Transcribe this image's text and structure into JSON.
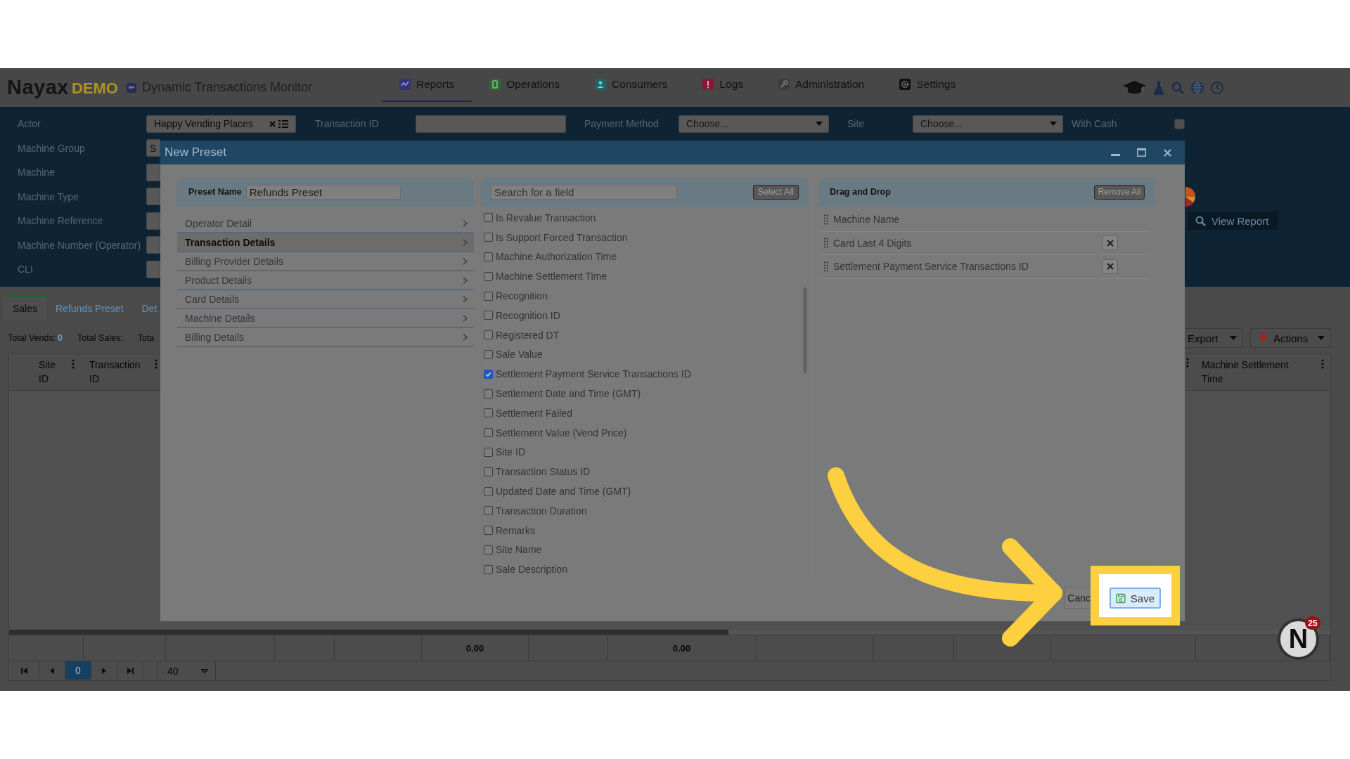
{
  "header": {
    "logo": "Nayax",
    "logo_badge": "DEMO",
    "app_title": "Dynamic Transactions Monitor",
    "nav": [
      {
        "label": "Reports",
        "selected": true
      },
      {
        "label": "Operations",
        "selected": false
      },
      {
        "label": "Consumers",
        "selected": false
      },
      {
        "label": "Logs",
        "selected": false
      },
      {
        "label": "Administration",
        "selected": false
      },
      {
        "label": "Settings",
        "selected": false
      }
    ]
  },
  "filters": {
    "actor": {
      "label": "Actor",
      "value": "Happy Vending Places"
    },
    "transaction_id": {
      "label": "Transaction ID"
    },
    "payment_method": {
      "label": "Payment Method",
      "placeholder": "Choose..."
    },
    "site": {
      "label": "Site",
      "placeholder": "Choose..."
    },
    "with_cash": {
      "label": "With Cash",
      "checked": false
    },
    "rows": [
      {
        "label": "Machine Group",
        "value": "S"
      },
      {
        "label": "Machine"
      },
      {
        "label": "Machine Type"
      },
      {
        "label": "Machine Reference"
      },
      {
        "label": "Machine Number (Operator)"
      },
      {
        "label": "CLI"
      }
    ],
    "view_report": "View Report"
  },
  "report_tabs": [
    {
      "label": "Sales",
      "selected": true
    },
    {
      "label": "Refunds Preset",
      "selected": false
    },
    {
      "label": "Det",
      "selected": false
    }
  ],
  "stats": [
    {
      "label": "Total Vends:",
      "value": "0"
    },
    {
      "label": "Total Sales:"
    },
    {
      "label": "Tota"
    }
  ],
  "toolbar": {
    "export": "Export",
    "actions": "Actions"
  },
  "table": {
    "columns": [
      {
        "label": "Site ID"
      },
      {
        "label": "Transaction ID"
      }
    ],
    "right_columns": [
      {
        "label": "Machine Settlement Time"
      }
    ],
    "totals": [
      "0.00",
      "0.00"
    ]
  },
  "pager": {
    "pages": [
      {
        "label": "0",
        "selected": true
      }
    ],
    "page_size": "40"
  },
  "chat": {
    "label": "N",
    "badge": "25"
  },
  "dialog": {
    "title": "New Preset",
    "preset_name": {
      "label": "Preset Name",
      "value": "Refunds Preset"
    },
    "categories": [
      {
        "label": "Operator Detail",
        "selected": false
      },
      {
        "label": "Transaction Details",
        "selected": true
      },
      {
        "label": "Billing Provider Details",
        "selected": false
      },
      {
        "label": "Product Details",
        "selected": false
      },
      {
        "label": "Card Details",
        "selected": false
      },
      {
        "label": "Machine Details",
        "selected": false
      },
      {
        "label": "Billing Details",
        "selected": false
      }
    ],
    "field_search": {
      "placeholder": "Search for a field"
    },
    "select_all": "Select All",
    "fields": [
      {
        "label": "Is Revalue Transaction",
        "checked": false
      },
      {
        "label": "Is Support Forced Transaction",
        "checked": false
      },
      {
        "label": "Machine Authorization Time",
        "checked": false
      },
      {
        "label": "Machine Settlement Time",
        "checked": false
      },
      {
        "label": "Recognition",
        "checked": false
      },
      {
        "label": "Recognition ID",
        "checked": false
      },
      {
        "label": "Registered DT",
        "checked": false
      },
      {
        "label": "Sale Value",
        "checked": false
      },
      {
        "label": "Settlement Payment Service Transactions ID",
        "checked": true
      },
      {
        "label": "Settlement Date and Time (GMT)",
        "checked": false
      },
      {
        "label": "Settlement Failed",
        "checked": false
      },
      {
        "label": "Settlement Value (Vend Price)",
        "checked": false
      },
      {
        "label": "Site ID",
        "checked": false
      },
      {
        "label": "Transaction Status ID",
        "checked": false
      },
      {
        "label": "Updated Date and Time (GMT)",
        "checked": false
      },
      {
        "label": "Transaction Duration",
        "checked": false
      },
      {
        "label": "Remarks",
        "checked": false
      },
      {
        "label": "Site Name",
        "checked": false
      },
      {
        "label": "Sale Description",
        "checked": false
      }
    ],
    "drag_title": "Drag and Drop",
    "remove_all": "Remove All",
    "selected_fields": [
      {
        "label": "Machine Name",
        "removable": false
      },
      {
        "label": "Card Last 4 Digits",
        "removable": true
      },
      {
        "label": "Settlement Payment Service Transactions ID",
        "removable": true
      }
    ],
    "cancel_button": "Canc",
    "save_button": "Save"
  }
}
